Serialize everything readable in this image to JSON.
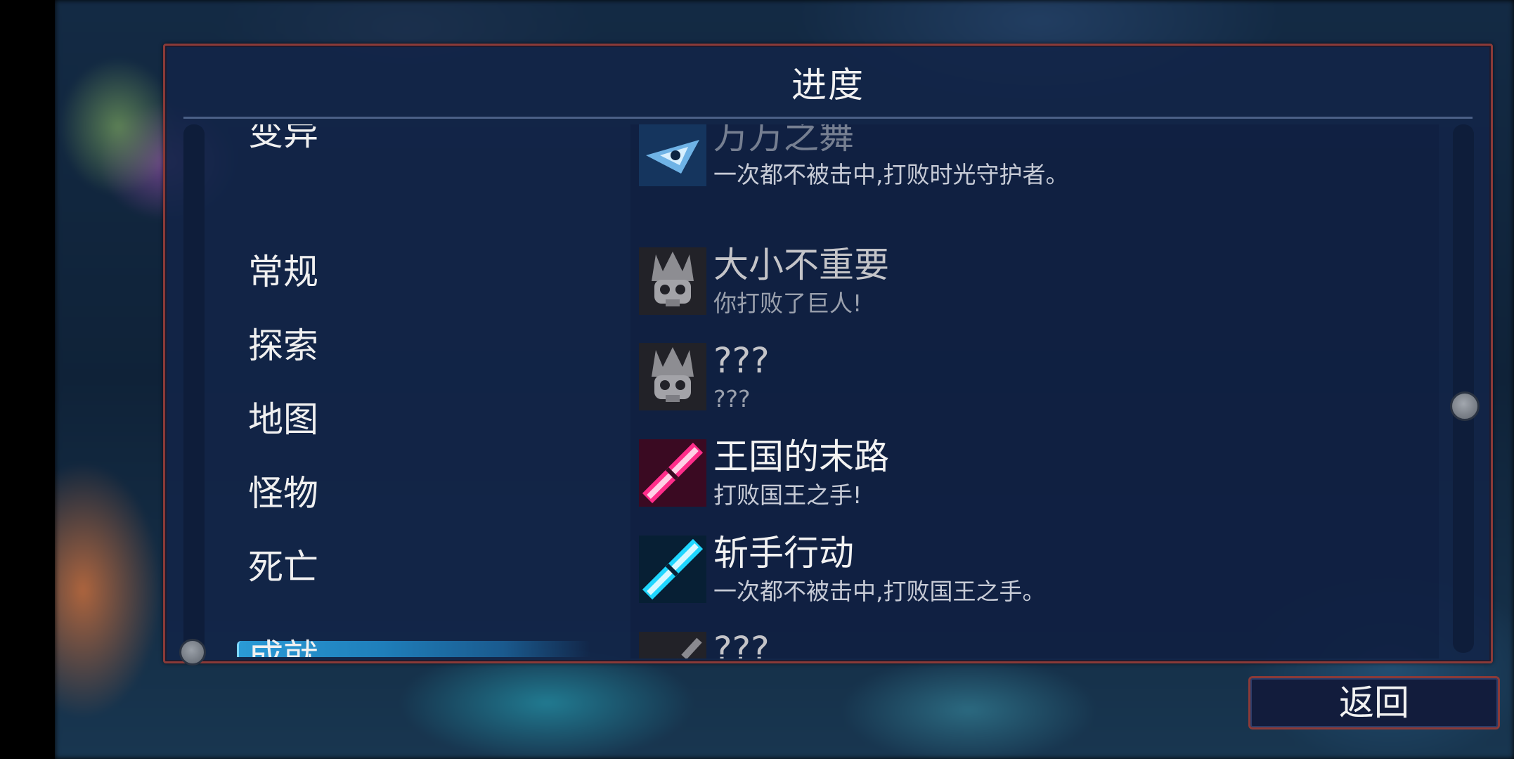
{
  "panel": {
    "title": "进度"
  },
  "categories": [
    {
      "label": "变异",
      "selected": false
    },
    {
      "label": "常规",
      "selected": false
    },
    {
      "label": "探索",
      "selected": false
    },
    {
      "label": "地图",
      "selected": false
    },
    {
      "label": "怪物",
      "selected": false
    },
    {
      "label": "死亡",
      "selected": false
    },
    {
      "label": "成就",
      "selected": true
    }
  ],
  "achievements": [
    {
      "title": "万万之舞",
      "desc": "一次都不被击中,打败时光守护者。",
      "icon": "time-guardian-icon",
      "unlocked": true
    },
    {
      "title": "大小不重要",
      "desc": "你打败了巨人!",
      "icon": "skull-crown-icon",
      "unlocked": false
    },
    {
      "title": "???",
      "desc": "???",
      "icon": "skull-crown-icon",
      "unlocked": false
    },
    {
      "title": "王国的末路",
      "desc": "打败国王之手!",
      "icon": "pink-sword-icon",
      "unlocked": true
    },
    {
      "title": "斩手行动",
      "desc": "一次都不被击中,打败国王之手。",
      "icon": "cyan-sword-icon",
      "unlocked": true
    },
    {
      "title": "???",
      "desc": "???",
      "icon": "broken-sword-icon",
      "unlocked": false
    }
  ],
  "back_button": {
    "label": "返回"
  },
  "colors": {
    "panel_border": "#8a3a38",
    "panel_bg": "#122448",
    "selected_highlight": "#2a9ad6",
    "pink_icon": "#ff2d8a",
    "cyan_icon": "#1fd6ff"
  }
}
